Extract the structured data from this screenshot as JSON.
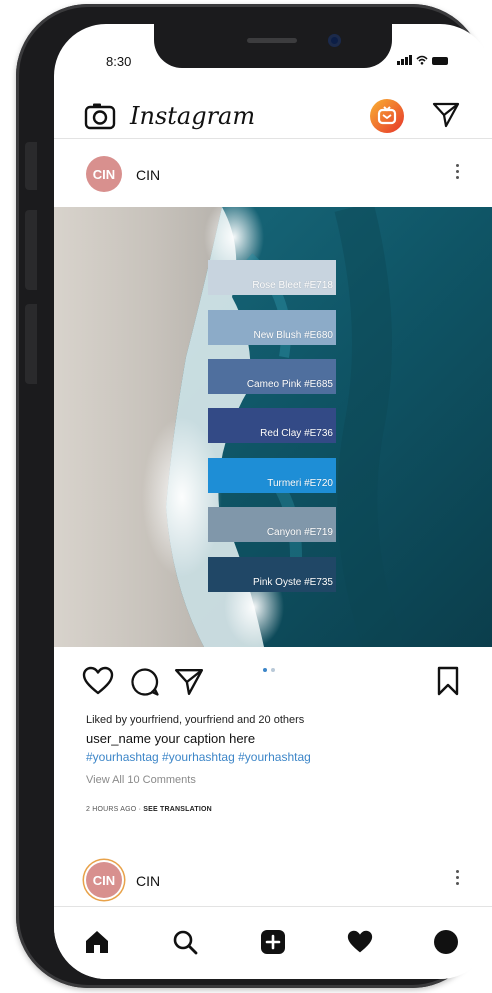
{
  "status_bar": {
    "time": "8:30"
  },
  "header": {
    "app_title": "Instagram",
    "icons": [
      "camera-icon",
      "igtv-icon",
      "direct-message-icon"
    ]
  },
  "post": {
    "username": "CIN",
    "avatar_text": "CIN",
    "swatches": [
      {
        "label": "Rose Bleet #E718",
        "color": "#c8d4df"
      },
      {
        "label": "New Blush #E680",
        "color": "#8cabc8"
      },
      {
        "label": "Cameo Pink #E685",
        "color": "#4f6f9e"
      },
      {
        "label": "Red Clay #E736",
        "color": "#334a86"
      },
      {
        "label": "Turmeri #E720",
        "color": "#1e8ed6"
      },
      {
        "label": "Canyon #E719",
        "color": "#8097aa"
      },
      {
        "label": "Pink Oyste #E735",
        "color": "#204766"
      }
    ],
    "carousel": {
      "page_count": 2,
      "active_index": 0
    },
    "likes_text": "Liked by yourfriend, yourfriend and 20 others",
    "caption_text": "user_name  your caption here",
    "hashtags_text": "#yourhashtag #yourhashtag #yourhashtag",
    "view_comments_text": "View All 10 Comments",
    "time_ago": "2 HOURS AGO",
    "separator": " · ",
    "see_translation": "SEE TRANSLATION"
  },
  "next_post": {
    "username": "CIN",
    "avatar_text": "CIN"
  },
  "bottom_nav": {
    "icons": [
      "home-icon",
      "search-icon",
      "new-post-icon",
      "activity-heart-icon",
      "profile-icon"
    ]
  },
  "colors": {
    "avatar": "#d8908e",
    "hashtag": "#3d86c8",
    "igtv_gradient_start": "#f9b233",
    "igtv_gradient_end": "#e6352b",
    "carousel_active": "#3d86c8",
    "carousel_inactive": "#b9c9d8"
  }
}
